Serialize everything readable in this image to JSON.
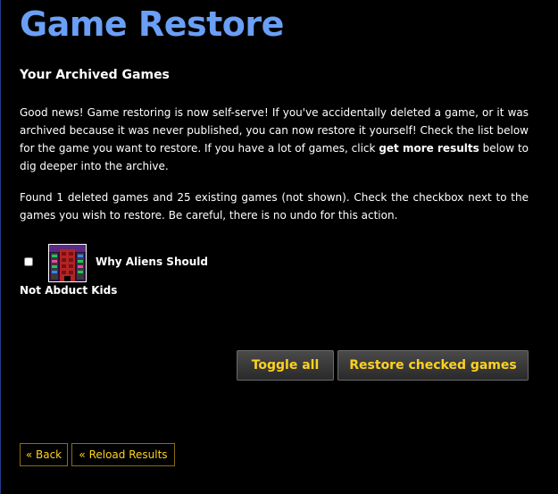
{
  "page": {
    "title": "Game Restore",
    "section_title": "Your Archived Games"
  },
  "intro": {
    "text_before": "Good news! Game restoring is now self-serve! If you've accidentally deleted a game, or it was archived because it was never published, you can now restore it yourself! Check the list below for the game you want to restore. If you have a lot of games, click ",
    "link_text": "get more results",
    "text_after": " below to dig deeper into the archive."
  },
  "found_text": "Found 1 deleted games and 25 existing games (not shown). Check the checkbox next to the games you wish to restore. Be careful, there is no undo for this action.",
  "games": [
    {
      "title_line1": "Why Aliens Should",
      "title_line2": "Not Abduct Kids",
      "checked": false
    }
  ],
  "actions": {
    "toggle_all": "Toggle all",
    "restore_checked": "Restore checked games"
  },
  "nav": {
    "back": "« Back",
    "reload": "« Reload Results"
  },
  "colors": {
    "background": "#000000",
    "title": "#6a9ff5",
    "button_text": "#ffd21f",
    "text": "#ffffff"
  }
}
